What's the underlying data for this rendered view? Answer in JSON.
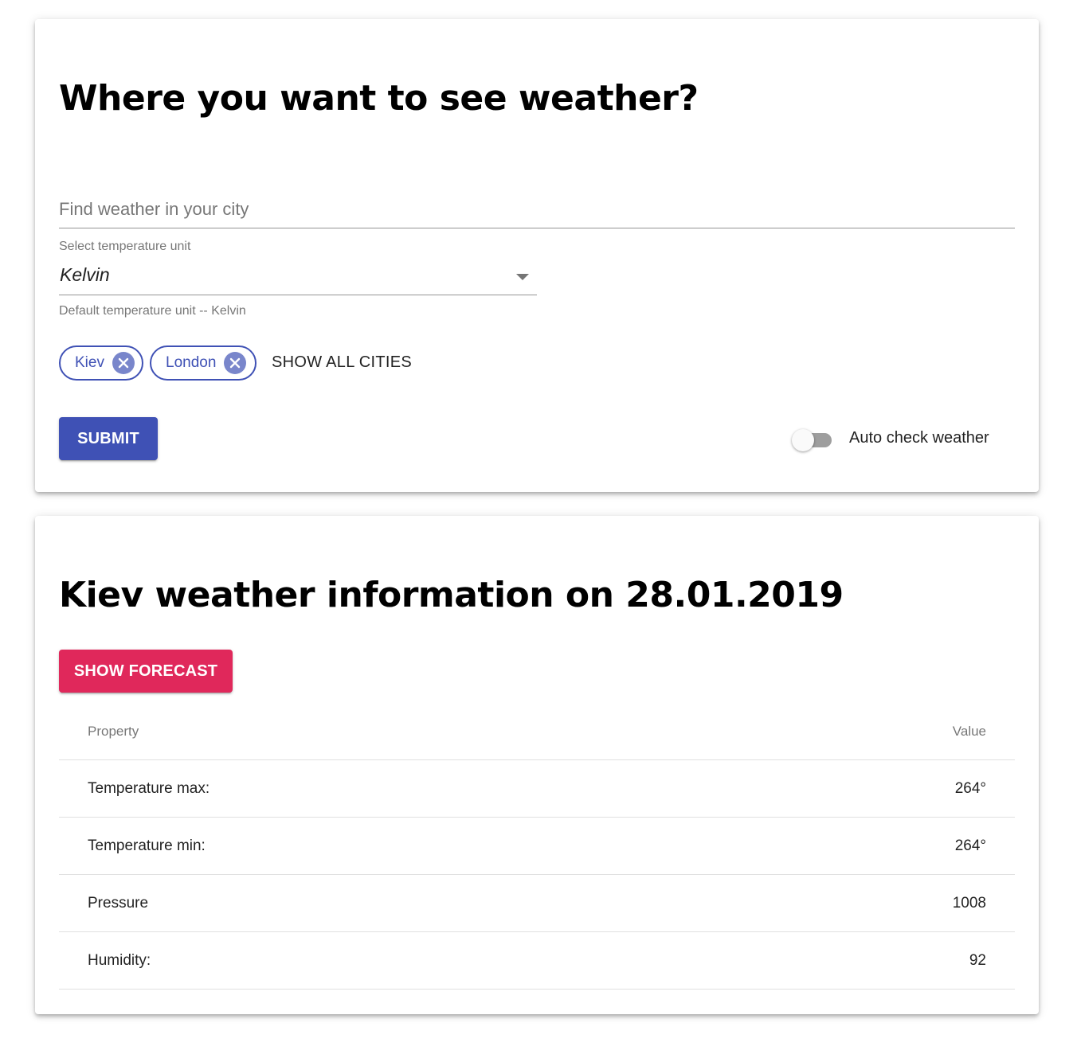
{
  "search": {
    "title": "Where you want to see weather?",
    "city_placeholder": "Find weather in your city",
    "unit_label": "Select temperature unit",
    "unit_value": "Kelvin",
    "unit_helper": "Default temperature unit -- Kelvin",
    "chips": [
      {
        "label": "Kiev"
      },
      {
        "label": "London"
      }
    ],
    "show_all_label": "SHOW ALL CITIES",
    "submit_label": "SUBMIT",
    "auto_check_label": "Auto check weather",
    "auto_check_on": false,
    "primary_color": "#3f51b5"
  },
  "info": {
    "title": "Kiev weather information on 28.01.2019",
    "forecast_label": "SHOW FORECAST",
    "secondary_color": "#e0285b",
    "table": {
      "headers": [
        "Property",
        "Value"
      ],
      "rows": [
        {
          "property": "Temperature max:",
          "value": "264°"
        },
        {
          "property": "Temperature min:",
          "value": "264°"
        },
        {
          "property": "Pressure",
          "value": "1008"
        },
        {
          "property": "Humidity:",
          "value": "92"
        }
      ]
    }
  }
}
